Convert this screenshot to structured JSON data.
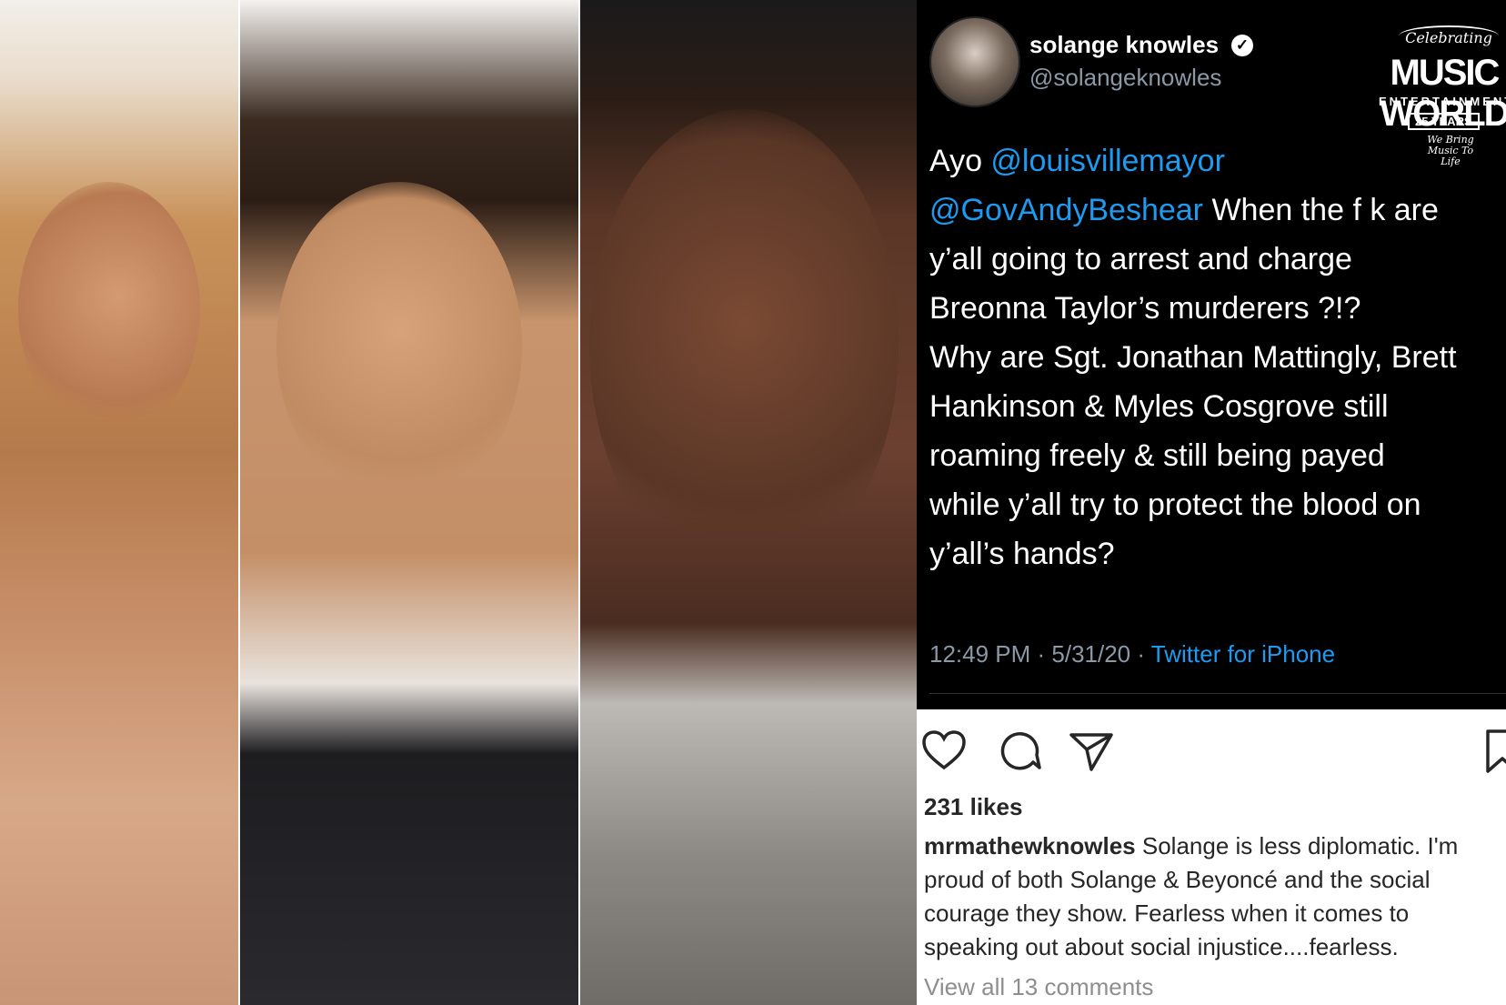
{
  "photos": [
    {
      "subject": "portrait-1"
    },
    {
      "subject": "portrait-2"
    },
    {
      "subject": "portrait-3"
    }
  ],
  "tweet": {
    "display_name": "solange knowles",
    "handle": "@solangeknowles",
    "body_lines": [
      [
        {
          "text": "Ayo ",
          "mention": false
        },
        {
          "text": "@louisvillemayor",
          "mention": true
        }
      ],
      [
        {
          "text": "@GovAndyBeshear",
          "mention": true
        },
        {
          "text": " When the f    k are",
          "mention": false
        }
      ],
      [
        {
          "text": "y’all going to arrest and charge",
          "mention": false
        }
      ],
      [
        {
          "text": "Breonna Taylor’s murderers ?!?",
          "mention": false
        }
      ],
      [
        {
          "text": "Why are Sgt. Jonathan Mattingly, Brett",
          "mention": false
        }
      ],
      [
        {
          "text": "Hankinson & Myles Cosgrove still",
          "mention": false
        }
      ],
      [
        {
          "text": "roaming freely & still being payed",
          "mention": false
        }
      ],
      [
        {
          "text": "while y’all try to protect the blood on",
          "mention": false
        }
      ],
      [
        {
          "text": "y’all’s hands?",
          "mention": false
        }
      ]
    ],
    "time": "12:49 PM · 5/31/20 · ",
    "source": "Twitter for iPhone",
    "mention_color": "#1d9bf0"
  },
  "logo": {
    "celebrating": "Celebrating",
    "title": "MUSIC WORLD",
    "subtitle": "ENTERTAINMENT",
    "years": "25 YEARS",
    "tagline": "We Bring Music To Life"
  },
  "instagram": {
    "likes": "231 likes",
    "caption_user": "mrmathewknowles",
    "caption_text": " Solange is less diplomatic. I'm proud of both Solange & Beyoncé and the social courage they show. Fearless when it comes to speaking out about social injustice....fearless.",
    "view_comments": "View all 13 comments",
    "icons": [
      "heart-icon",
      "comment-icon",
      "share-icon",
      "bookmark-icon"
    ]
  }
}
